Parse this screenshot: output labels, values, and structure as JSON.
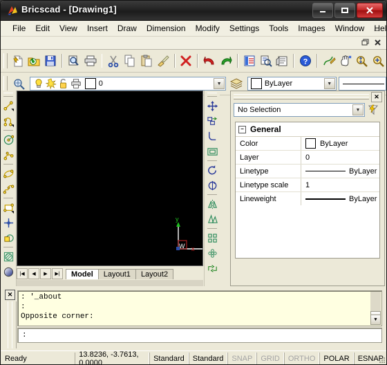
{
  "window": {
    "title": "Bricscad - [Drawing1]",
    "controls": {
      "minimize": "—",
      "maximize": "❐",
      "close": "✕"
    },
    "mdi_controls": {
      "minimize": "_",
      "restore": "❐",
      "close": "✕"
    }
  },
  "menubar": {
    "items": [
      {
        "label": "File"
      },
      {
        "label": "Edit"
      },
      {
        "label": "View"
      },
      {
        "label": "Insert"
      },
      {
        "label": "Draw"
      },
      {
        "label": "Dimension"
      },
      {
        "label": "Modify"
      },
      {
        "label": "Settings"
      },
      {
        "label": "Tools"
      },
      {
        "label": "Images"
      },
      {
        "label": "Window"
      },
      {
        "label": "Help"
      }
    ]
  },
  "standard_toolbar": {
    "buttons": [
      {
        "name": "new-icon"
      },
      {
        "name": "open-icon"
      },
      {
        "name": "save-icon"
      },
      {
        "name": "print-preview-icon"
      },
      {
        "name": "print-icon"
      },
      {
        "name": "cut-icon"
      },
      {
        "name": "copy-icon"
      },
      {
        "name": "paste-icon"
      },
      {
        "name": "match-properties-icon"
      },
      {
        "name": "erase-icon"
      },
      {
        "name": "undo-icon"
      },
      {
        "name": "redo-icon"
      },
      {
        "name": "properties-icon"
      },
      {
        "name": "inquiry-icon"
      },
      {
        "name": "drawing-explorer-icon"
      },
      {
        "name": "help-icon"
      },
      {
        "name": "polyline-edit-icon"
      },
      {
        "name": "pan-icon"
      },
      {
        "name": "zoom-realtime-icon"
      },
      {
        "name": "zoom-window-icon"
      }
    ]
  },
  "layer_toolbar": {
    "layer_states_icon": "layer-states-icon",
    "layer": {
      "on_icon": "lightbulb-icon",
      "freeze_icon": "freeze-sun-icon",
      "lock_icon": "unlock-icon",
      "plot_icon": "plot-printer-icon",
      "color": "#ffffff",
      "name": "0"
    },
    "layers_icon": "layers-icon",
    "color": {
      "swatch": "#ffffff",
      "label": "ByLayer"
    },
    "linetype": {
      "label": ""
    }
  },
  "draw_toolbar": {
    "tools": [
      {
        "name": "line-icon"
      },
      {
        "name": "polyline-icon"
      },
      {
        "name": "circle-icon"
      },
      {
        "name": "arc-icon"
      },
      {
        "name": "ellipse-icon"
      },
      {
        "name": "spline-icon"
      },
      {
        "name": "rectangle-icon"
      },
      {
        "name": "point-icon"
      },
      {
        "name": "polygon-icon"
      },
      {
        "name": "hatch-icon"
      },
      {
        "name": "gradient-icon"
      }
    ]
  },
  "modify_toolbar": {
    "tools": [
      {
        "name": "move-icon"
      },
      {
        "name": "copy-object-icon"
      },
      {
        "name": "fillet-icon"
      },
      {
        "name": "offset-icon"
      },
      {
        "name": "rotate-icon"
      },
      {
        "name": "revolve-icon"
      },
      {
        "name": "mirror-icon"
      },
      {
        "name": "scale-icon"
      },
      {
        "name": "array-icon"
      },
      {
        "name": "pattern-icon"
      },
      {
        "name": "stretch-icon"
      }
    ]
  },
  "drawing_area": {
    "background": "#000000",
    "ucs": {
      "x_label": "x",
      "y_label": "y",
      "wcs_label": "W",
      "x_color": "#d02020",
      "y_color": "#20c020"
    }
  },
  "layout_tabs": {
    "nav": [
      {
        "name": "first-tab-button",
        "glyph": "|◀"
      },
      {
        "name": "prev-tab-button",
        "glyph": "◀"
      },
      {
        "name": "next-tab-button",
        "glyph": "▶"
      },
      {
        "name": "last-tab-button",
        "glyph": "▶|"
      }
    ],
    "tabs": [
      {
        "label": "Model",
        "active": true
      },
      {
        "label": "Layout1",
        "active": false
      },
      {
        "label": "Layout2",
        "active": false
      }
    ]
  },
  "properties_panel": {
    "close_label": "✕",
    "selection": "No Selection",
    "filter_icon": "quick-select-icon",
    "group": {
      "label": "General",
      "expander": "−"
    },
    "rows": [
      {
        "key": "Color",
        "value": "ByLayer",
        "type": "color",
        "swatch": "#ffffff"
      },
      {
        "key": "Layer",
        "value": "0",
        "type": "text"
      },
      {
        "key": "Linetype",
        "value": "ByLayer",
        "type": "linetype"
      },
      {
        "key": "Linetype scale",
        "value": "1",
        "type": "text"
      },
      {
        "key": "Lineweight",
        "value": "ByLayer",
        "type": "lineweight"
      }
    ]
  },
  "command_line": {
    "close_label": "✕",
    "history": [
      ": '_about",
      ":",
      "Opposite corner:"
    ],
    "prompt": ":",
    "scroll": {
      "up": "▲",
      "down": "▼"
    }
  },
  "status_bar": {
    "message": "Ready",
    "coordinates": "13.8236, -3.7613, 0.0000",
    "cells": [
      {
        "label": "Standard",
        "enabled": true
      },
      {
        "label": "Standard",
        "enabled": true
      },
      {
        "label": "SNAP",
        "enabled": false
      },
      {
        "label": "GRID",
        "enabled": false
      },
      {
        "label": "ORTHO",
        "enabled": false
      },
      {
        "label": "POLAR",
        "enabled": true
      },
      {
        "label": "ESNAP",
        "enabled": true
      }
    ]
  }
}
